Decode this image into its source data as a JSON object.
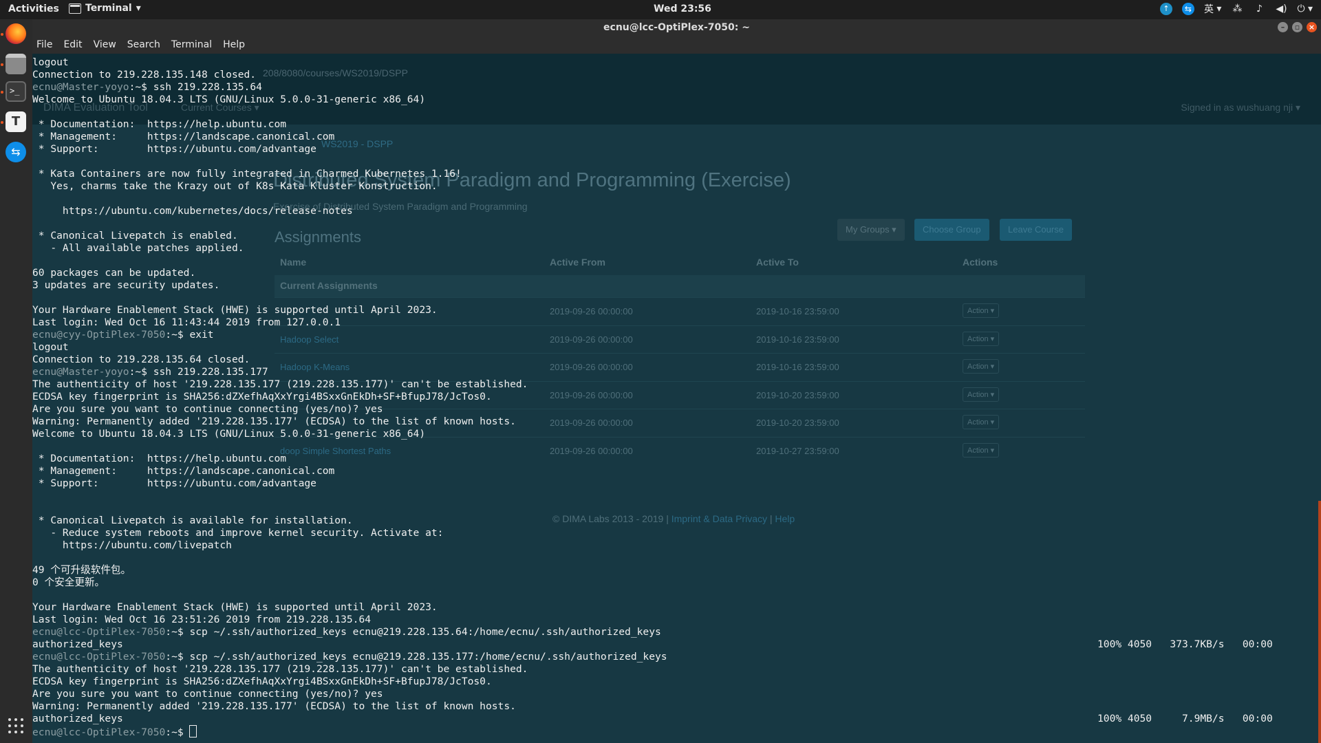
{
  "topbar": {
    "activities": "Activities",
    "app_name": "Terminal",
    "clock": "Wed 23:56",
    "input_method": "英"
  },
  "window": {
    "title": "ecnu@lcc-OptiPlex-7050: ~",
    "menu": [
      "File",
      "Edit",
      "View",
      "Search",
      "Terminal",
      "Help"
    ]
  },
  "background_browser": {
    "url": "208/8080/courses/WS2019/DSPP",
    "brand": "DIMA Evaluation Tool",
    "current_courses": "Current Courses ▾",
    "signed_in": "Signed in as wushuang nji ▾",
    "breadcrumb": "WS2019 - DSPP",
    "title": "Distributed System Paradigm and Programming (Exercise)",
    "subtitle": "Exercise of Distributed System Paradigm and Programming",
    "assignments_heading": "Assignments",
    "buttons": {
      "groups": "My Groups ▾",
      "choose": "Choose Group",
      "leave": "Leave Course"
    },
    "columns": [
      "Name",
      "Active From",
      "Active To",
      "Actions"
    ],
    "current_label": "Current Assignments",
    "rows": [
      {
        "name": "",
        "from": "2019-09-26 00:00:00",
        "to": "2019-10-16 23:59:00",
        "action": "Action ▾"
      },
      {
        "name": "Hadoop Select",
        "from": "2019-09-26 00:00:00",
        "to": "2019-10-16 23:59:00",
        "action": "Action ▾"
      },
      {
        "name": "Hadoop K-Means",
        "from": "2019-09-26 00:00:00",
        "to": "2019-10-16 23:59:00",
        "action": "Action ▾"
      },
      {
        "name": "",
        "from": "2019-09-26 00:00:00",
        "to": "2019-10-20 23:59:00",
        "action": "Action ▾"
      },
      {
        "name": "",
        "from": "2019-09-26 00:00:00",
        "to": "2019-10-20 23:59:00",
        "action": "Action ▾"
      },
      {
        "name": "doop Simple Shortest Paths",
        "from": "2019-09-26 00:00:00",
        "to": "2019-10-27 23:59:00",
        "action": "Action ▾"
      }
    ],
    "footer_text": "© DIMA Labs 2013 - 2019 |",
    "footer_link1": "Imprint & Data Privacy",
    "footer_sep": "|",
    "footer_link2": "Help"
  },
  "terminal": {
    "lines": [
      "logout",
      "Connection to 219.228.135.148 closed.",
      {
        "p": "ecnu@Master-yoyo",
        "c": ":~$ ssh 219.228.135.64"
      },
      "Welcome to Ubuntu 18.04.3 LTS (GNU/Linux 5.0.0-31-generic x86_64)",
      "",
      " * Documentation:  https://help.ubuntu.com",
      " * Management:     https://landscape.canonical.com",
      " * Support:        https://ubuntu.com/advantage",
      "",
      " * Kata Containers are now fully integrated in Charmed Kubernetes 1.16!",
      "   Yes, charms take the Krazy out of K8s Kata Kluster Konstruction.",
      "",
      "     https://ubuntu.com/kubernetes/docs/release-notes",
      "",
      " * Canonical Livepatch is enabled.",
      "   - All available patches applied.",
      "",
      "60 packages can be updated.",
      "3 updates are security updates.",
      "",
      "Your Hardware Enablement Stack (HWE) is supported until April 2023.",
      "Last login: Wed Oct 16 11:43:44 2019 from 127.0.0.1",
      {
        "p": "ecnu@cyy-OptiPlex-7050",
        "c": ":~$ exit"
      },
      "logout",
      "Connection to 219.228.135.64 closed.",
      {
        "p": "ecnu@Master-yoyo",
        "c": ":~$ ssh 219.228.135.177"
      },
      "The authenticity of host '219.228.135.177 (219.228.135.177)' can't be established.",
      "ECDSA key fingerprint is SHA256:dZXefhAqXxYrgi4BSxxGnEkDh+SF+BfupJ78/JcTos0.",
      "Are you sure you want to continue connecting (yes/no)? yes",
      "Warning: Permanently added '219.228.135.177' (ECDSA) to the list of known hosts.",
      "Welcome to Ubuntu 18.04.3 LTS (GNU/Linux 5.0.0-31-generic x86_64)",
      "",
      " * Documentation:  https://help.ubuntu.com",
      " * Management:     https://landscape.canonical.com",
      " * Support:        https://ubuntu.com/advantage",
      "",
      "",
      " * Canonical Livepatch is available for installation.",
      "   - Reduce system reboots and improve kernel security. Activate at:",
      "     https://ubuntu.com/livepatch",
      "",
      "49 个可升级软件包。",
      "0 个安全更新。",
      "",
      "Your Hardware Enablement Stack (HWE) is supported until April 2023.",
      "Last login: Wed Oct 16 23:51:26 2019 from 219.228.135.64",
      {
        "p": "ecnu@lcc-OptiPlex-7050",
        "c": ":~$ scp ~/.ssh/authorized_keys ecnu@219.228.135.64:/home/ecnu/.ssh/authorized_keys"
      },
      "authorized_keys",
      {
        "p": "ecnu@lcc-OptiPlex-7050",
        "c": ":~$ scp ~/.ssh/authorized_keys ecnu@219.228.135.177:/home/ecnu/.ssh/authorized_keys"
      },
      "The authenticity of host '219.228.135.177 (219.228.135.177)' can't be established.",
      "ECDSA key fingerprint is SHA256:dZXefhAqXxYrgi4BSxxGnEkDh+SF+BfupJ78/JcTos0.",
      "Are you sure you want to continue connecting (yes/no)? yes",
      "Warning: Permanently added '219.228.135.177' (ECDSA) to the list of known hosts.",
      "authorized_keys",
      {
        "p": "ecnu@lcc-OptiPlex-7050",
        "c": ":~$ ",
        "cursor": true
      }
    ],
    "progress": [
      {
        "line": 47,
        "text": "100% 4050   373.7KB/s   00:00"
      },
      {
        "line": 53,
        "text": "100% 4050     7.9MB/s   00:00"
      }
    ]
  },
  "colors": {
    "terminal_bg": "#173843",
    "prompt": "#8c9ea3",
    "accent": "#e95420"
  }
}
